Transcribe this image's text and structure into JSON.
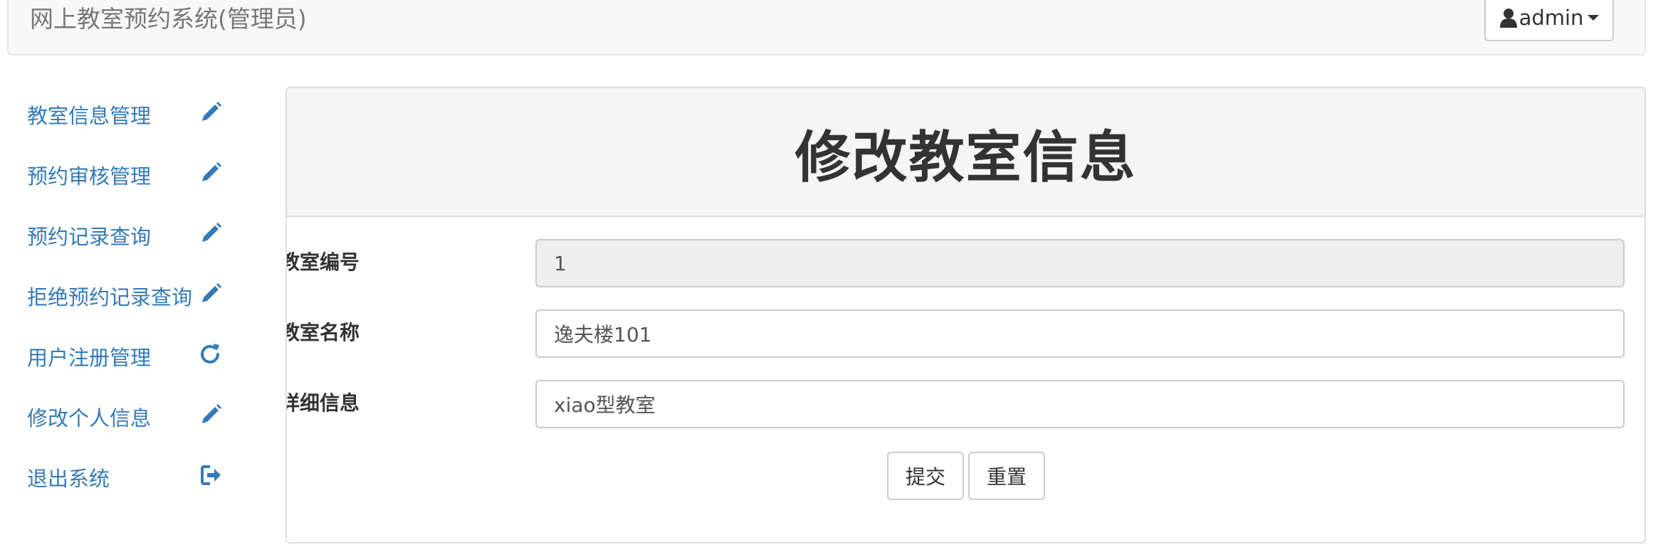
{
  "header": {
    "brand": "网上教室预约系统(管理员)",
    "user_label": "admin",
    "user_icon": "user-icon",
    "caret_icon": "caret-down-icon"
  },
  "sidebar": {
    "items": [
      {
        "label": "教室信息管理",
        "icon": "pencil-icon"
      },
      {
        "label": "预约审核管理",
        "icon": "pencil-icon"
      },
      {
        "label": "预约记录查询",
        "icon": "pencil-icon"
      },
      {
        "label": "拒绝预约记录查询",
        "icon": "pencil-icon"
      },
      {
        "label": "用户注册管理",
        "icon": "refresh-icon"
      },
      {
        "label": "修改个人信息",
        "icon": "pencil-icon"
      },
      {
        "label": "退出系统",
        "icon": "logout-icon"
      }
    ]
  },
  "panel": {
    "title": "修改教室信息"
  },
  "form": {
    "fields": [
      {
        "label": "教室编号",
        "value": "1",
        "readonly": true
      },
      {
        "label": "教室名称",
        "value": "逸夫楼101",
        "readonly": false
      },
      {
        "label": "教室详细信息",
        "value": "xiao型教室",
        "readonly": false
      }
    ],
    "submit_label": "提交",
    "reset_label": "重置"
  },
  "colors": {
    "link": "#337ab7",
    "navbar_bg": "#f8f8f8",
    "panel_heading_bg": "#f5f5f5",
    "readonly_bg": "#eeeeee"
  }
}
